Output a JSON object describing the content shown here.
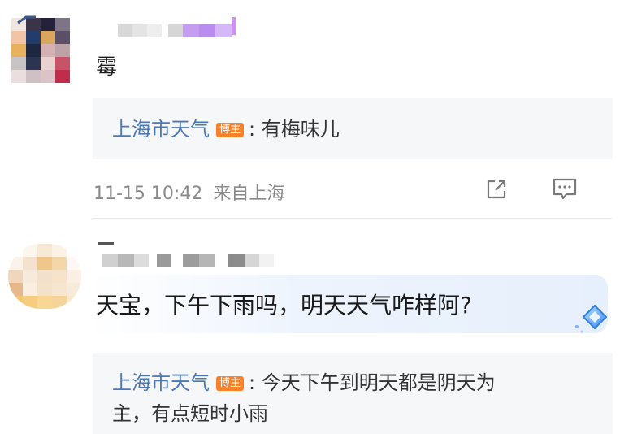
{
  "comment1": {
    "text": "霉",
    "reply": {
      "author": "上海市天气",
      "badge": "博主",
      "separator": ":",
      "text": "有梅味儿"
    },
    "meta": {
      "timestamp": "11-15 10:42",
      "location": "来自上海"
    }
  },
  "comment2": {
    "text": "天宝，下午下雨吗，明天天气咋样阿?",
    "reply": {
      "author": "上海市天气",
      "badge": "博主",
      "separator": ":",
      "text_line1": "今天下午到明天都是阴天为",
      "text_line2": "主，有点短时小雨"
    }
  },
  "colors": {
    "author_blue": "#4a78b8",
    "badge_orange": "#f8822a",
    "reply_bg": "#f6f7f9",
    "meta_gray": "#8a8a8a"
  },
  "icons": [
    "share-icon",
    "comment-icon",
    "ai-diamond-icon"
  ]
}
